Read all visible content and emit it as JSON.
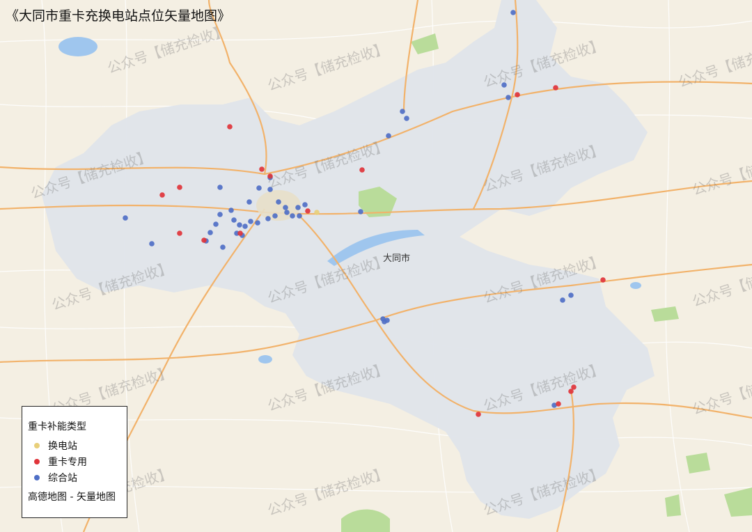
{
  "title": "《大同市重卡充换电站点位矢量地图》",
  "city_label": "大同市",
  "watermark_text": "公众号【储充检收】",
  "legend": {
    "title": "重卡补能类型",
    "items": [
      {
        "label": "换电站",
        "color": "#e8cf7a"
      },
      {
        "label": "重卡专用",
        "color": "#e0343a"
      },
      {
        "label": "综合站",
        "color": "#4f6fc6"
      }
    ],
    "source": "高德地图 - 矢量地图"
  },
  "stations": {
    "heavy_truck_dedicated": [
      [
        330,
        182
      ],
      [
        376,
        243
      ],
      [
        520,
        244
      ],
      [
        388,
        253
      ],
      [
        258,
        269
      ],
      [
        233,
        280
      ],
      [
        258,
        335
      ],
      [
        293,
        345
      ],
      [
        345,
        335
      ],
      [
        442,
        303
      ],
      [
        798,
        126
      ],
      [
        743,
        136
      ],
      [
        866,
        402
      ],
      [
        824,
        556
      ],
      [
        820,
        562
      ],
      [
        802,
        580
      ],
      [
        687,
        595
      ]
    ],
    "comprehensive": [
      [
        737,
        18
      ],
      [
        724,
        122
      ],
      [
        730,
        140
      ],
      [
        578,
        160
      ],
      [
        584,
        170
      ],
      [
        558,
        195
      ],
      [
        388,
        255
      ],
      [
        372,
        270
      ],
      [
        388,
        272
      ],
      [
        358,
        290
      ],
      [
        180,
        313
      ],
      [
        316,
        269
      ],
      [
        332,
        302
      ],
      [
        316,
        308
      ],
      [
        310,
        322
      ],
      [
        302,
        334
      ],
      [
        296,
        346
      ],
      [
        218,
        350
      ],
      [
        320,
        355
      ],
      [
        336,
        316
      ],
      [
        344,
        323
      ],
      [
        352,
        325
      ],
      [
        340,
        335
      ],
      [
        348,
        338
      ],
      [
        360,
        318
      ],
      [
        370,
        320
      ],
      [
        385,
        314
      ],
      [
        395,
        310
      ],
      [
        400,
        290
      ],
      [
        412,
        305
      ],
      [
        420,
        310
      ],
      [
        428,
        298
      ],
      [
        438,
        294
      ],
      [
        430,
        310
      ],
      [
        410,
        298
      ],
      [
        518,
        304
      ],
      [
        820,
        424
      ],
      [
        808,
        431
      ],
      [
        550,
        458
      ],
      [
        552,
        462
      ],
      [
        556,
        460
      ],
      [
        796,
        582
      ]
    ],
    "swap_station": [
      [
        455,
        305
      ]
    ]
  },
  "colors": {
    "land": "#f4efe3",
    "region": "#dfe4ea",
    "water": "#9fc6ee",
    "park": "#b9dc9a",
    "road_major": "#f2b26a",
    "road_minor": "#ffffff"
  }
}
